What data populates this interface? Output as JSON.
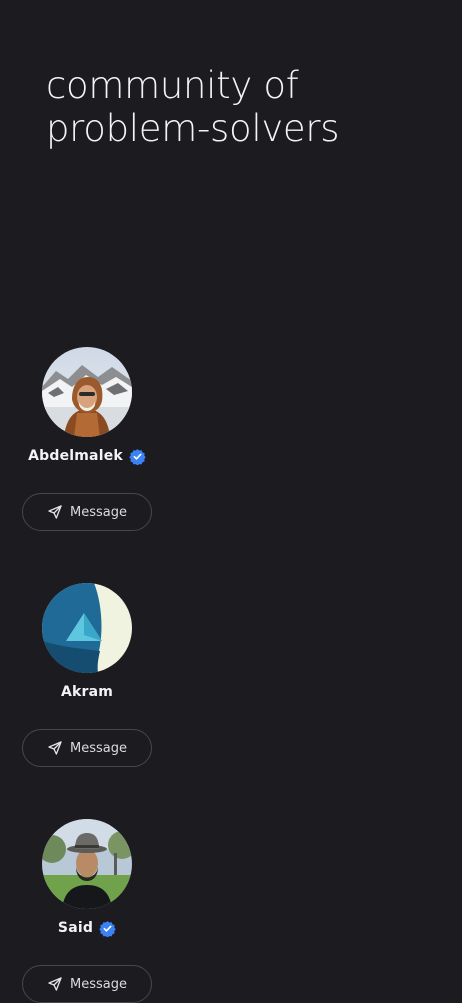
{
  "headline": {
    "line1": "community of",
    "line2": "problem-solvers"
  },
  "members": [
    {
      "name": "Abdelmalek",
      "verified": true,
      "action_label": "Message",
      "avatar": "photo-person-mountains"
    },
    {
      "name": "Akram",
      "verified": false,
      "action_label": "Message",
      "avatar": "logo-blue-triangle"
    },
    {
      "name": "Said",
      "verified": true,
      "action_label": "Message",
      "avatar": "photo-person-hat"
    }
  ],
  "icons": {
    "verified": "verified-badge-icon",
    "message": "paper-plane-icon"
  },
  "colors": {
    "background": "#1c1b20",
    "verified_badge": "#3b82f6",
    "button_border": "#47464d"
  }
}
